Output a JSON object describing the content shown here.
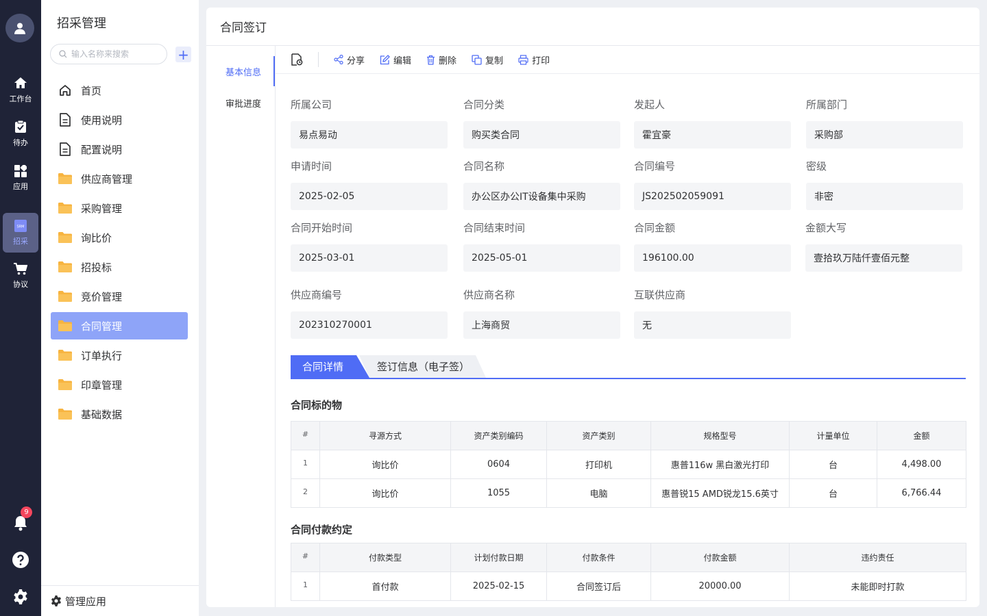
{
  "rail": {
    "items": [
      {
        "label": "工作台",
        "icon": "home-icon"
      },
      {
        "label": "待办",
        "icon": "clipboard-icon"
      },
      {
        "label": "应用",
        "icon": "apps-grid-icon"
      },
      {
        "label": "招采",
        "icon": "srm-icon"
      },
      {
        "label": "协议",
        "icon": "cart-icon"
      }
    ],
    "srm_text": "SRM",
    "notification_count": "9",
    "active": "招采"
  },
  "sidebar": {
    "title": "招采管理",
    "search_placeholder": "输入名称来搜索",
    "add_label": "+",
    "items": [
      {
        "label": "首页",
        "icon": "home-outline-icon"
      },
      {
        "label": "使用说明",
        "icon": "document-icon"
      },
      {
        "label": "配置说明",
        "icon": "document-icon"
      },
      {
        "label": "供应商管理",
        "icon": "folder-icon"
      },
      {
        "label": "采购管理",
        "icon": "folder-icon"
      },
      {
        "label": "询比价",
        "icon": "folder-icon"
      },
      {
        "label": "招投标",
        "icon": "folder-icon"
      },
      {
        "label": "竞价管理",
        "icon": "folder-icon"
      },
      {
        "label": "合同管理",
        "icon": "folder-icon"
      },
      {
        "label": "订单执行",
        "icon": "folder-icon"
      },
      {
        "label": "印章管理",
        "icon": "folder-icon"
      },
      {
        "label": "基础数据",
        "icon": "folder-icon"
      }
    ],
    "active": "合同管理",
    "manage_label": "管理应用"
  },
  "page": {
    "title": "合同签订",
    "side_tabs": [
      "基本信息",
      "审批进度"
    ],
    "active_side_tab": "基本信息"
  },
  "toolbar": {
    "actions": [
      {
        "label": "分享",
        "icon": "share-icon"
      },
      {
        "label": "编辑",
        "icon": "edit-icon"
      },
      {
        "label": "删除",
        "icon": "trash-icon"
      },
      {
        "label": "复制",
        "icon": "copy-icon"
      },
      {
        "label": "打印",
        "icon": "print-icon"
      }
    ]
  },
  "form": {
    "fields": [
      {
        "label": "所属公司",
        "value": "易点易动"
      },
      {
        "label": "合同分类",
        "value": "购买类合同"
      },
      {
        "label": "发起人",
        "value": "霍宜豪"
      },
      {
        "label": "所属部门",
        "value": "采购部"
      },
      {
        "label": "申请时间",
        "value": "2025-02-05"
      },
      {
        "label": "合同名称",
        "value": "办公区办公IT设备集中采购"
      },
      {
        "label": "合同编号",
        "value": "JS202502059091"
      },
      {
        "label": "密级",
        "value": "非密"
      },
      {
        "label": "合同开始时间",
        "value": "2025-03-01"
      },
      {
        "label": "合同结束时间",
        "value": "2025-05-01"
      },
      {
        "label": "合同金额",
        "value": "196100.00"
      },
      {
        "label": "金额大写",
        "value": "壹拾玖万陆仟壹佰元整"
      },
      {
        "label": "供应商编号",
        "value": "202310270001"
      },
      {
        "label": "供应商名称",
        "value": "上海商贸"
      },
      {
        "label": "互联供应商",
        "value": "无"
      }
    ]
  },
  "doc_tabs": {
    "active": "合同详情",
    "other": "签订信息（电子签）"
  },
  "items_table": {
    "title": "合同标的物",
    "headers": [
      "#",
      "寻源方式",
      "资产类别编码",
      "资产类别",
      "规格型号",
      "计量单位",
      "金额"
    ],
    "rows": [
      [
        "1",
        "询比价",
        "0604",
        "打印机",
        "惠普116w 黑白激光打印",
        "台",
        "4,498.00"
      ],
      [
        "2",
        "询比价",
        "1055",
        "电脑",
        "惠普锐15 AMD锐龙15.6英寸",
        "台",
        "6,766.44"
      ]
    ]
  },
  "payment_table": {
    "title": "合同付款约定",
    "headers": [
      "#",
      "付款类型",
      "计划付款日期",
      "付款条件",
      "付款金额",
      "违约责任"
    ],
    "rows": [
      [
        "1",
        "首付款",
        "2025-02-15",
        "合同签订后",
        "20000.00",
        "未能即时打款"
      ]
    ]
  },
  "colors": {
    "rail_bg": "#1f2337",
    "accent": "#4f6cf5",
    "active_nav": "#8ea4f8",
    "folder": "#f7b440",
    "badge": "#f5465d"
  }
}
